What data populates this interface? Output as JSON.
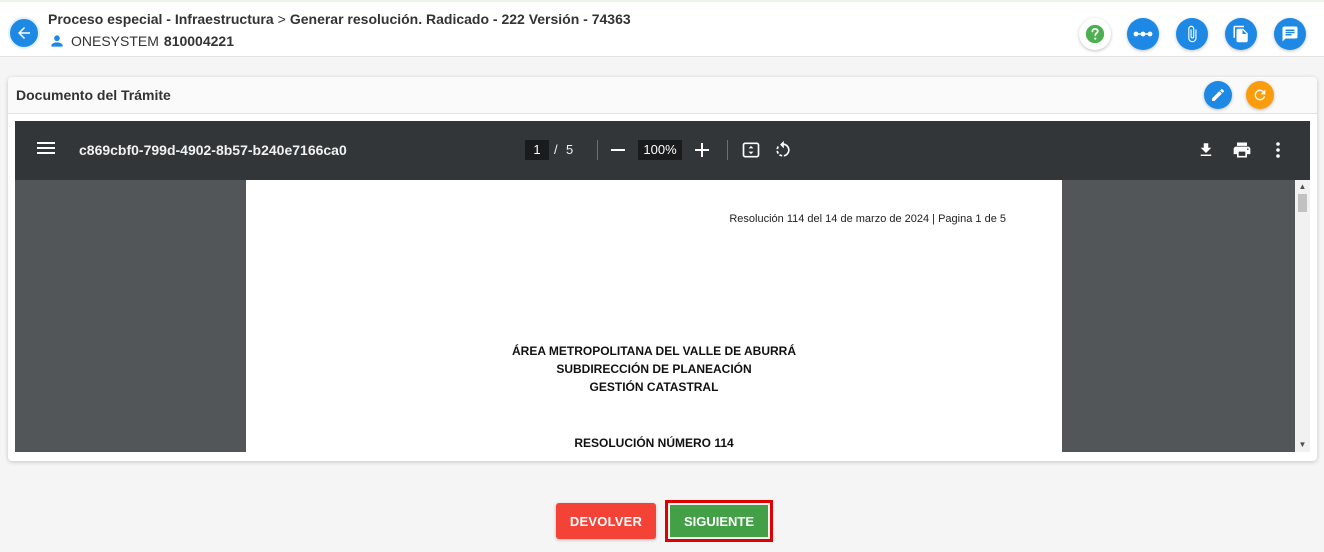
{
  "header": {
    "breadcrumb_part1": "Proceso especial - Infraestructura",
    "breadcrumb_separator": ">",
    "breadcrumb_part2": "Generar resolución. Radicado - 222 Versión - 74363",
    "user_name": "ONESYSTEM",
    "user_id": "810004221"
  },
  "icons": {
    "back": "arrow-left-icon",
    "user": "person-icon",
    "help": "question-icon",
    "more": "more-horizontal-icon",
    "attach": "paperclip-icon",
    "copy": "copy-icon",
    "comments": "comment-icon",
    "edit": "pencil-icon",
    "refresh": "refresh-icon"
  },
  "colors": {
    "primary": "#1e88e5",
    "help_green": "#4caf50",
    "refresh_orange": "#fb9c0c",
    "devolver_red": "#f44336",
    "siguiente_green": "#43a047",
    "highlight_red": "#e00000"
  },
  "panel": {
    "title": "Documento del Trámite"
  },
  "viewer": {
    "filename": "c869cbf0-799d-4902-8b57-b240e7166ca0",
    "current_page": "1",
    "page_separator": "/",
    "total_pages": "5",
    "zoom": "100%"
  },
  "document": {
    "header_line": "Resolución 114 del 14 de marzo de 2024 | Pagina 1 de 5",
    "org_line1": "ÁREA METROPOLITANA DEL VALLE DE ABURRÁ",
    "org_line2": "SUBDIRECCIÓN DE PLANEACIÓN",
    "org_line3": "GESTIÓN CATASTRAL",
    "resolution_title": "RESOLUCIÓN NÚMERO 114"
  },
  "actions": {
    "devolver_label": "DEVOLVER",
    "siguiente_label": "SIGUIENTE"
  }
}
